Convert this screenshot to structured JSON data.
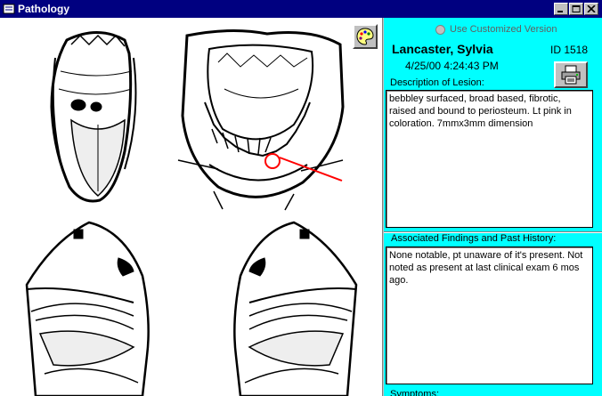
{
  "window": {
    "title": "Pathology"
  },
  "panel": {
    "use_customized_label": "Use Customized Version",
    "patient_name": "Lancaster, Sylvia",
    "id_label": "ID 1518",
    "datetime": "4/25/00 4:24:43 PM",
    "description_label": "Description of Lesion:",
    "description_text": "bebbley surfaced, broad based, fibrotic, raised and bound to periosteum. Lt pink in coloration. 7mmx3mm dimension",
    "associated_label": "Associated Findings and Past History:",
    "associated_text": "None notable, pt unaware of it's present. Not noted as present at last clinical exam 6 mos ago.",
    "symptoms_label": "Symptoms:"
  },
  "colors": {
    "title_bar": "#000080",
    "panel_bg": "#00ffff",
    "lesion_marker": "#ff0000"
  },
  "icons": {
    "palette": "palette-icon",
    "print": "printer-icon"
  }
}
